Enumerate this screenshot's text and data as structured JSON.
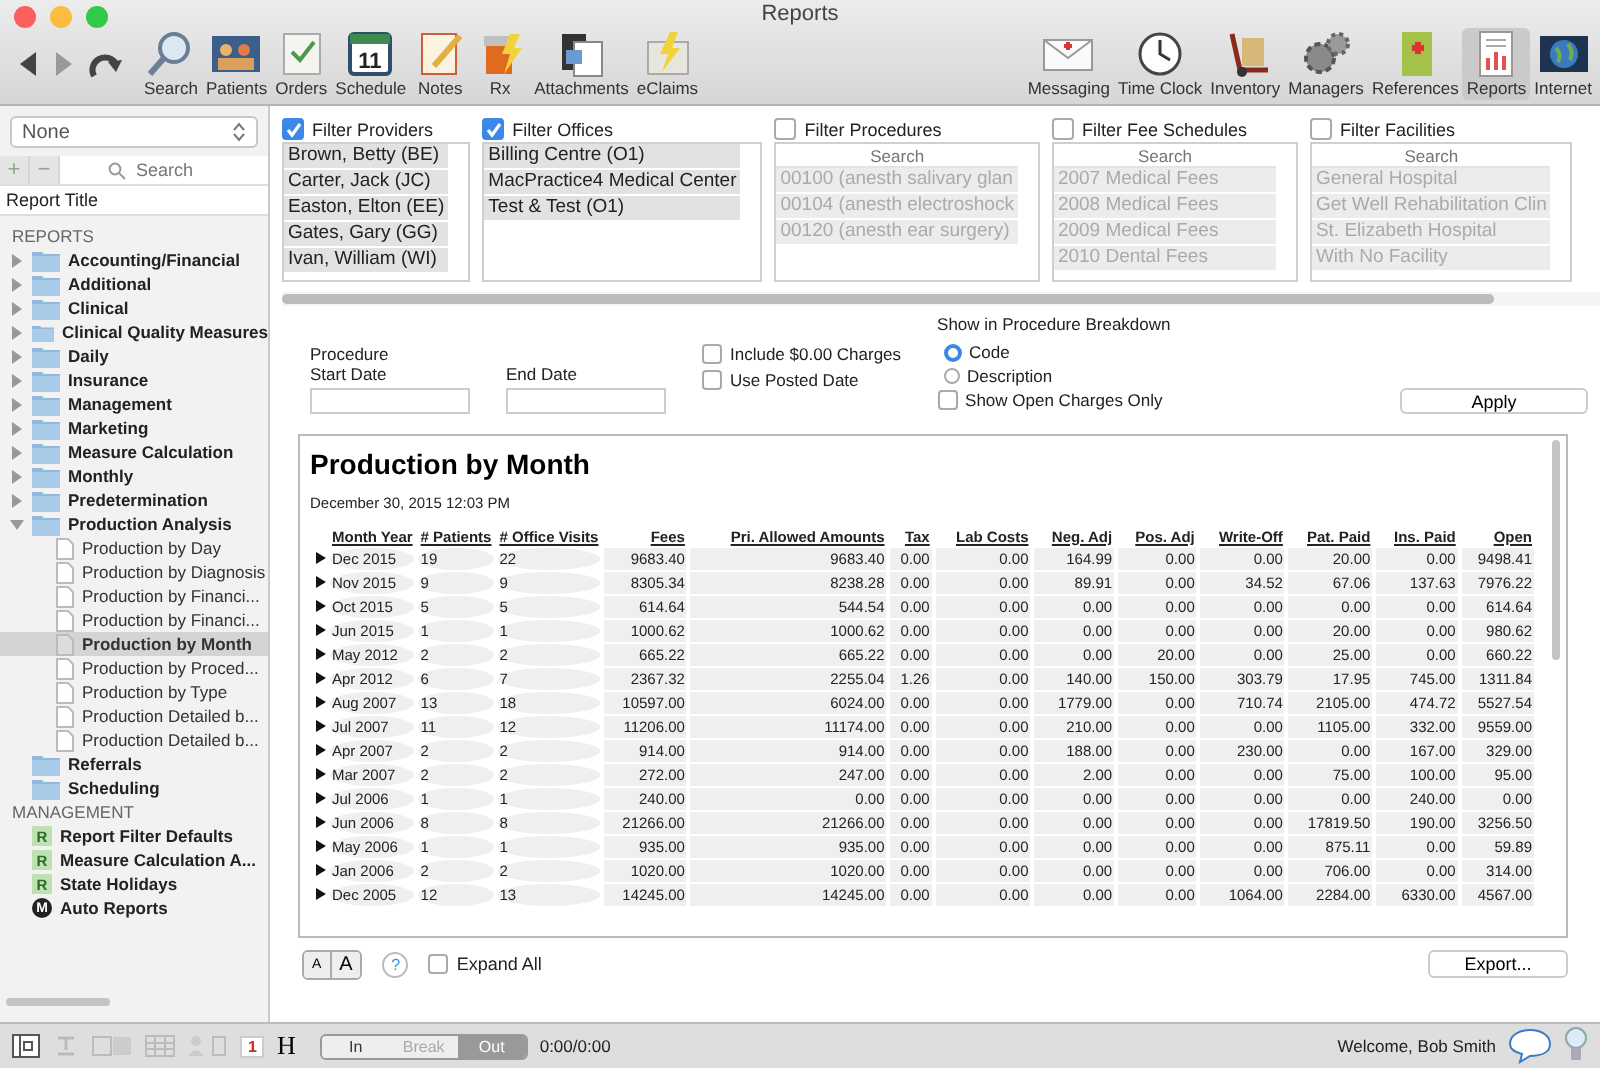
{
  "window": {
    "title": "Reports"
  },
  "toolbar": {
    "nav": [
      {
        "kind": "back",
        "disabled": false
      },
      {
        "kind": "forward",
        "disabled": true
      },
      {
        "kind": "redo",
        "disabled": false
      }
    ],
    "left": [
      {
        "label": "Search",
        "kind": "search",
        "selected": false
      },
      {
        "label": "Patients",
        "kind": "patients",
        "selected": false
      },
      {
        "label": "Orders",
        "kind": "orders",
        "selected": false
      },
      {
        "label": "Schedule",
        "kind": "schedule",
        "selected": false,
        "icon_text": "11"
      },
      {
        "label": "Notes",
        "kind": "notes",
        "selected": false
      },
      {
        "label": "Rx",
        "kind": "rx",
        "selected": false
      },
      {
        "label": "Attachments",
        "kind": "attachments",
        "selected": false
      },
      {
        "label": "eClaims",
        "kind": "eclaims",
        "selected": false
      }
    ],
    "right": [
      {
        "label": "Messaging",
        "kind": "messaging",
        "selected": false
      },
      {
        "label": "Time Clock",
        "kind": "clock",
        "selected": false
      },
      {
        "label": "Inventory",
        "kind": "inventory",
        "selected": false
      },
      {
        "label": "Managers",
        "kind": "managers",
        "selected": false
      },
      {
        "label": "References",
        "kind": "references",
        "selected": false
      },
      {
        "label": "Reports",
        "kind": "reports",
        "selected": true
      },
      {
        "label": "Internet",
        "kind": "internet",
        "selected": false
      }
    ]
  },
  "sidebar": {
    "selector": "None",
    "add": "+",
    "remove": "−",
    "search_placeholder": "Search",
    "column": "Report Title",
    "sections": [
      {
        "title": "REPORTS",
        "items": [
          {
            "label": "Accounting/Financial",
            "kind": "group",
            "expanded": false
          },
          {
            "label": "Additional",
            "kind": "group",
            "expanded": false
          },
          {
            "label": "Clinical",
            "kind": "group",
            "expanded": false
          },
          {
            "label": "Clinical Quality Measures",
            "kind": "group",
            "expanded": false
          },
          {
            "label": "Daily",
            "kind": "group",
            "expanded": false
          },
          {
            "label": "Insurance",
            "kind": "group",
            "expanded": false
          },
          {
            "label": "Management",
            "kind": "group",
            "expanded": false
          },
          {
            "label": "Marketing",
            "kind": "group",
            "expanded": false
          },
          {
            "label": "Measure Calculation",
            "kind": "group",
            "expanded": false
          },
          {
            "label": "Monthly",
            "kind": "group",
            "expanded": false
          },
          {
            "label": "Predetermination",
            "kind": "group",
            "expanded": false
          },
          {
            "label": "Production Analysis",
            "kind": "group",
            "expanded": true,
            "children": [
              {
                "label": "Production by Day",
                "selected": false
              },
              {
                "label": "Production by Diagnosis",
                "selected": false
              },
              {
                "label": "Production by Financi...",
                "selected": false
              },
              {
                "label": "Production by Financi...",
                "selected": false
              },
              {
                "label": "Production by Month",
                "selected": true
              },
              {
                "label": "Production by Proced...",
                "selected": false
              },
              {
                "label": "Production by Type",
                "selected": false
              },
              {
                "label": "Production Detailed b...",
                "selected": false
              },
              {
                "label": "Production Detailed b...",
                "selected": false
              }
            ]
          },
          {
            "label": "Referrals",
            "kind": "folder"
          },
          {
            "label": "Scheduling",
            "kind": "folder"
          }
        ]
      },
      {
        "title": "MANAGEMENT",
        "items": [
          {
            "label": "Report Filter Defaults",
            "kind": "tag",
            "badge": "R"
          },
          {
            "label": "Measure Calculation A...",
            "kind": "tag",
            "badge": "R"
          },
          {
            "label": "State Holidays",
            "kind": "tag",
            "badge": "R"
          },
          {
            "label": "Auto Reports",
            "kind": "circle",
            "badge": "M"
          }
        ]
      }
    ]
  },
  "filters": [
    {
      "label": "Filter Providers",
      "checked": true,
      "items": [
        "Brown, Betty (BE)",
        "Carter, Jack (JC)",
        "Easton, Elton (EE)",
        "Gates, Gary (GG)",
        "Ivan, William (WI)"
      ]
    },
    {
      "label": "Filter Offices",
      "checked": true,
      "items": [
        "Billing Centre (O1)",
        "MacPractice4 Medical Center",
        "Test & Test (O1)"
      ]
    },
    {
      "label": "Filter Procedures",
      "checked": false,
      "search_placeholder": "Search",
      "items": [
        "00100 (anesth salivary glan",
        "00104 (anesth electroshock",
        "00120 (anesth ear surgery)"
      ]
    },
    {
      "label": "Filter Fee Schedules",
      "checked": false,
      "search_placeholder": "Search",
      "items": [
        "2007 Medical Fees",
        "2008 Medical Fees",
        "2009 Medical Fees",
        "2010 Dental Fees"
      ]
    },
    {
      "label": "Filter Facilities",
      "checked": false,
      "search_placeholder": "Search",
      "items": [
        "General Hospital",
        "Get Well Rehabilitation Clin",
        "St. Elizabeth Hospital",
        "With No Facility"
      ]
    }
  ],
  "options": {
    "start_label": "Procedure Start Date",
    "end_label": "End Date",
    "checks": [
      {
        "label": "Include $0.00 Charges",
        "checked": false
      },
      {
        "label": "Use Posted Date",
        "checked": false
      }
    ],
    "breakdown": {
      "title": "Show in Procedure Breakdown",
      "options": [
        {
          "label": "Code",
          "selected": true
        },
        {
          "label": "Description",
          "selected": false
        }
      ]
    },
    "open_only": {
      "label": "Show Open Charges Only",
      "checked": false
    },
    "apply": "Apply"
  },
  "report": {
    "title": "Production by Month",
    "timestamp": "December 30, 2015 12:03 PM",
    "columns": [
      "Month Year",
      "# Patients",
      "# Office Visits",
      "Fees",
      "Pri. Allowed Amounts",
      "Tax",
      "Lab Costs",
      "Neg. Adj",
      "Pos. Adj",
      "Write-Off",
      "Pat. Paid",
      "Ins. Paid",
      "Open"
    ],
    "rows": [
      {
        "expanded": false,
        "cells": [
          "Dec 2015",
          "19",
          "22",
          "9683.40",
          "9683.40",
          "0.00",
          "0.00",
          "164.99",
          "0.00",
          "0.00",
          "20.00",
          "0.00",
          "9498.41"
        ]
      },
      {
        "expanded": false,
        "cells": [
          "Nov 2015",
          "9",
          "9",
          "8305.34",
          "8238.28",
          "0.00",
          "0.00",
          "89.91",
          "0.00",
          "34.52",
          "67.06",
          "137.63",
          "7976.22"
        ]
      },
      {
        "expanded": false,
        "cells": [
          "Oct 2015",
          "5",
          "5",
          "614.64",
          "544.54",
          "0.00",
          "0.00",
          "0.00",
          "0.00",
          "0.00",
          "0.00",
          "0.00",
          "614.64"
        ]
      },
      {
        "expanded": false,
        "cells": [
          "Jun 2015",
          "1",
          "1",
          "1000.62",
          "1000.62",
          "0.00",
          "0.00",
          "0.00",
          "0.00",
          "0.00",
          "20.00",
          "0.00",
          "980.62"
        ]
      },
      {
        "expanded": false,
        "cells": [
          "May 2012",
          "2",
          "2",
          "665.22",
          "665.22",
          "0.00",
          "0.00",
          "0.00",
          "20.00",
          "0.00",
          "25.00",
          "0.00",
          "660.22"
        ]
      },
      {
        "expanded": false,
        "cells": [
          "Apr 2012",
          "6",
          "7",
          "2367.32",
          "2255.04",
          "1.26",
          "0.00",
          "140.00",
          "150.00",
          "303.79",
          "17.95",
          "745.00",
          "1311.84"
        ]
      },
      {
        "expanded": false,
        "cells": [
          "Aug 2007",
          "13",
          "18",
          "10597.00",
          "6024.00",
          "0.00",
          "0.00",
          "1779.00",
          "0.00",
          "710.74",
          "2105.00",
          "474.72",
          "5527.54"
        ]
      },
      {
        "expanded": false,
        "cells": [
          "Jul 2007",
          "11",
          "12",
          "11206.00",
          "11174.00",
          "0.00",
          "0.00",
          "210.00",
          "0.00",
          "0.00",
          "1105.00",
          "332.00",
          "9559.00"
        ]
      },
      {
        "expanded": false,
        "cells": [
          "Apr 2007",
          "2",
          "2",
          "914.00",
          "914.00",
          "0.00",
          "0.00",
          "188.00",
          "0.00",
          "230.00",
          "0.00",
          "167.00",
          "329.00"
        ]
      },
      {
        "expanded": false,
        "cells": [
          "Mar 2007",
          "2",
          "2",
          "272.00",
          "247.00",
          "0.00",
          "0.00",
          "2.00",
          "0.00",
          "0.00",
          "75.00",
          "100.00",
          "95.00"
        ]
      },
      {
        "expanded": false,
        "cells": [
          "Jul 2006",
          "1",
          "1",
          "240.00",
          "0.00",
          "0.00",
          "0.00",
          "0.00",
          "0.00",
          "0.00",
          "0.00",
          "240.00",
          "0.00"
        ]
      },
      {
        "expanded": false,
        "cells": [
          "Jun 2006",
          "8",
          "8",
          "21266.00",
          "21266.00",
          "0.00",
          "0.00",
          "0.00",
          "0.00",
          "0.00",
          "17819.50",
          "190.00",
          "3256.50"
        ]
      },
      {
        "expanded": false,
        "cells": [
          "May 2006",
          "1",
          "1",
          "935.00",
          "935.00",
          "0.00",
          "0.00",
          "0.00",
          "0.00",
          "0.00",
          "875.11",
          "0.00",
          "59.89"
        ]
      },
      {
        "expanded": false,
        "cells": [
          "Jan 2006",
          "2",
          "2",
          "1020.00",
          "1020.00",
          "0.00",
          "0.00",
          "0.00",
          "0.00",
          "0.00",
          "706.00",
          "0.00",
          "314.00"
        ]
      },
      {
        "expanded": false,
        "cells": [
          "Dec 2005",
          "12",
          "13",
          "14245.00",
          "14245.00",
          "0.00",
          "0.00",
          "0.00",
          "0.00",
          "1064.00",
          "2284.00",
          "6330.00",
          "4567.00"
        ]
      }
    ]
  },
  "footer": {
    "font_buttons": [
      "A",
      "A"
    ],
    "help": "?",
    "expand_all": {
      "label": "Expand All",
      "checked": false
    },
    "export": "Export..."
  },
  "status_bar": {
    "badge": "1",
    "heading_button": "H",
    "clock": [
      {
        "label": "In",
        "selected": false,
        "disabled": false
      },
      {
        "label": "Break",
        "selected": false,
        "disabled": true
      },
      {
        "label": "Out",
        "selected": true,
        "disabled": false
      }
    ],
    "time": "0:00/0:00",
    "welcome": "Welcome, Bob Smith"
  }
}
